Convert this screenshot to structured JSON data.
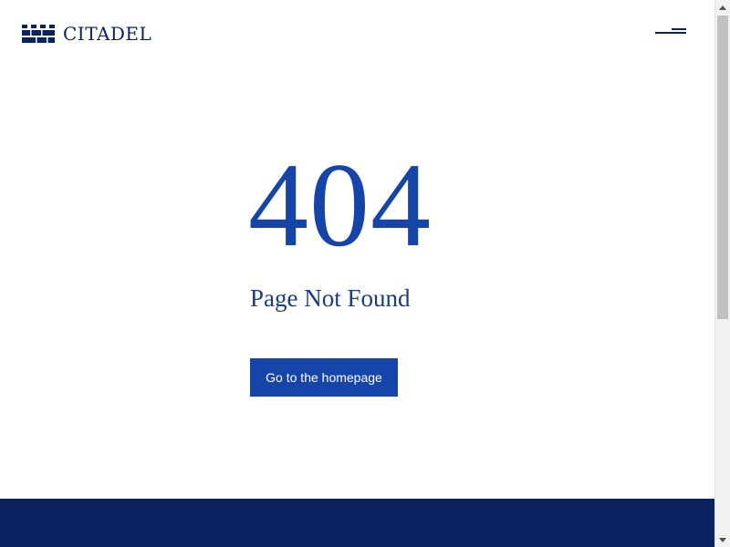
{
  "header": {
    "logo_text": "CITADEL",
    "logo_icon": "citadel-battlement-logo",
    "menu_icon": "hamburger-menu-icon"
  },
  "main": {
    "error_code": "404",
    "error_title": "Page Not Found",
    "home_button_label": "Go to the homepage"
  },
  "colors": {
    "brand_navy": "#0b2260",
    "accent_blue": "#1545a8",
    "title_blue": "#1c3c7e",
    "background": "#ffffff"
  },
  "scrollbar": {
    "icons": [
      "scroll-up-arrow-icon",
      "scroll-down-arrow-icon"
    ]
  }
}
